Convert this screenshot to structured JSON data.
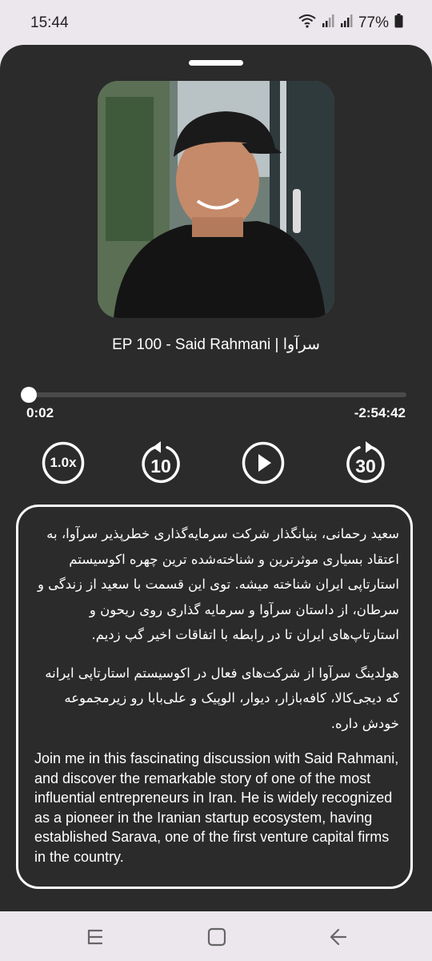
{
  "status_bar": {
    "time": "15:44",
    "battery": "77%",
    "icons": [
      "wifi-icon",
      "signal-icon",
      "signal-icon",
      "battery-icon"
    ]
  },
  "player": {
    "episode_title": "EP 100  - Said Rahmani | سرآوا",
    "elapsed": "0:02",
    "remaining": "-2:54:42",
    "progress_fraction": 0.0002,
    "speed_label": "1.0x",
    "rewind_label": "10",
    "forward_label": "30"
  },
  "description": {
    "fa_paragraph_1": "سعید رحمانی، بنیانگذار شرکت سرمایه‌گذاری خطرپذیر سرآوا، به اعتقاد بسیاری موثرترین و شناخته‌شده ترین چهره اکوسیستم استارتاپی ایران شناخته میشه. توی این قسمت با سعید از زندگی و سرطان، از داستان سرآوا و سرمایه گذاری روی ریحون و استارتاپ‌های ایران تا در رابطه با اتفاقات اخیر گپ زدیم.",
    "fa_paragraph_2": "هولدینگ سرآوا از شرکت‌های فعال در اکوسیستم استارتاپی ایرانه که دیجی‌کالا، کافه‌بازار، دیوار، الوپیک و علی‌بابا رو زیرمجموعه خودش داره.",
    "en_paragraph": "Join me in this fascinating discussion with Said Rahmani, and discover the remarkable story of one of the most influential entrepreneurs in Iran. He is widely recognized as a pioneer in the Iranian startup ecosystem, having established Sarava, one of the first venture capital firms in the country."
  },
  "nav_bar": {
    "icons": [
      "recent-apps-icon",
      "home-icon",
      "back-icon"
    ]
  },
  "colors": {
    "sheet_background": "#2b2b2b",
    "system_bar": "#ece7ec",
    "accent": "#ffffff"
  }
}
